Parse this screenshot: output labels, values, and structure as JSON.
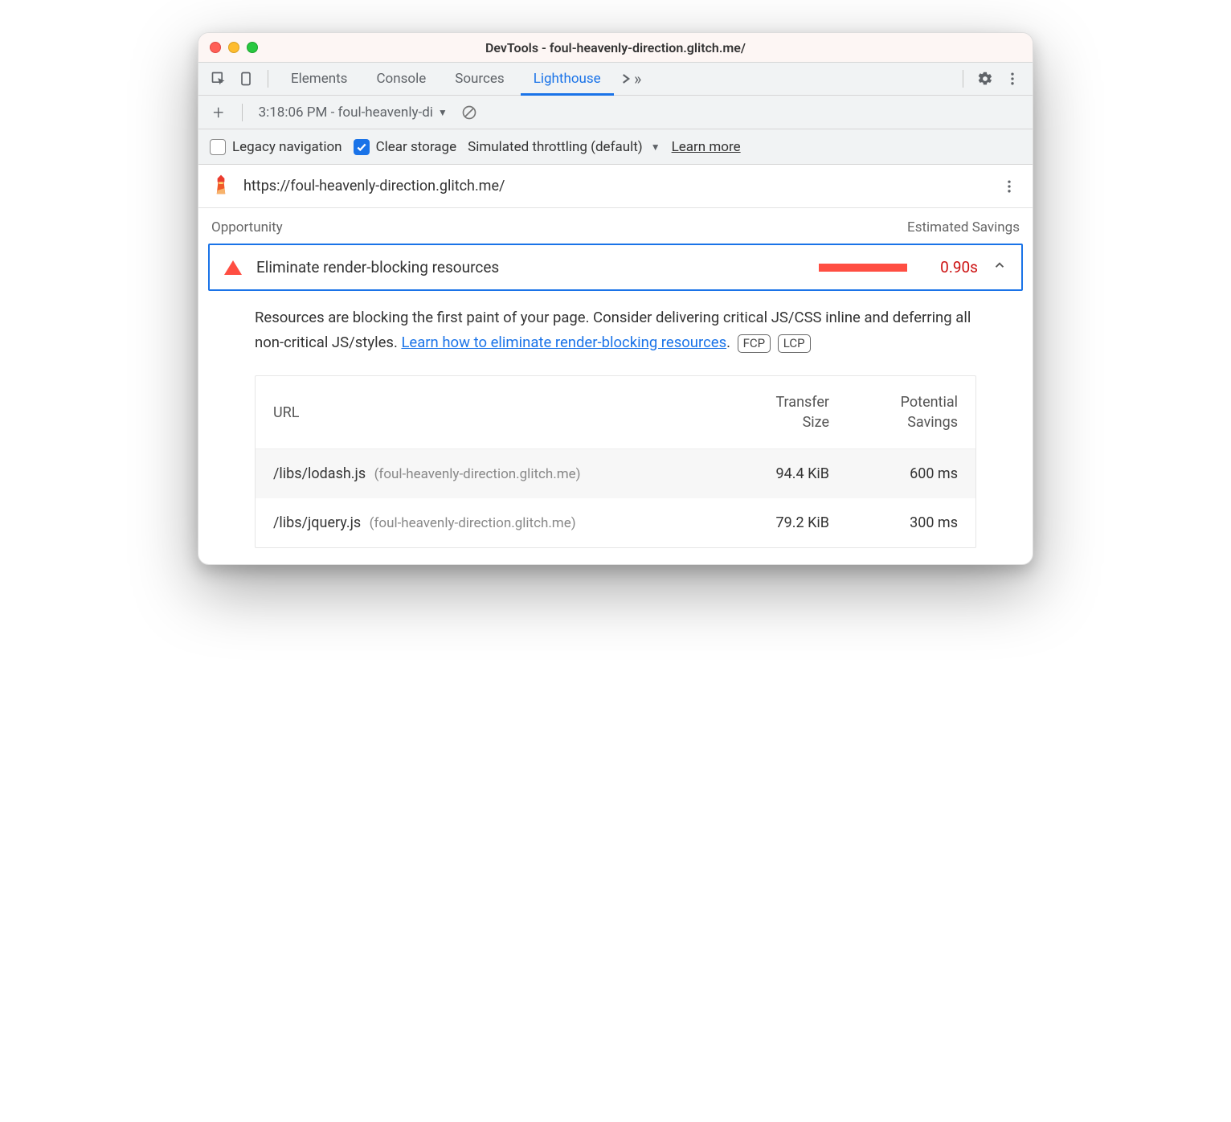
{
  "window": {
    "title": "DevTools - foul-heavenly-direction.glitch.me/"
  },
  "tabs": {
    "items": [
      "Elements",
      "Console",
      "Sources",
      "Lighthouse"
    ],
    "active": "Lighthouse"
  },
  "subbar": {
    "report_label": "3:18:06 PM - foul-heavenly-di"
  },
  "options": {
    "legacy_label": "Legacy navigation",
    "legacy_checked": false,
    "clear_label": "Clear storage",
    "clear_checked": true,
    "throttling_label": "Simulated throttling (default)",
    "learn_more": "Learn more"
  },
  "url_row": {
    "url": "https://foul-heavenly-direction.glitch.me/"
  },
  "opportunity": {
    "heading_left": "Opportunity",
    "heading_right": "Estimated Savings",
    "title": "Eliminate render-blocking resources",
    "savings": "0.90s"
  },
  "description": {
    "text_before_link": "Resources are blocking the first paint of your page. Consider delivering critical JS/CSS inline and deferring all non-critical JS/styles. ",
    "link_text": "Learn how to eliminate render-blocking resources",
    "text_after_link": ".",
    "badges": [
      "FCP",
      "LCP"
    ]
  },
  "table": {
    "headers": {
      "url": "URL",
      "size": "Transfer\nSize",
      "savings": "Potential\nSavings"
    },
    "rows": [
      {
        "path": "/libs/lodash.js",
        "host": "(foul-heavenly-direction.glitch.me)",
        "size": "94.4 KiB",
        "savings": "600 ms"
      },
      {
        "path": "/libs/jquery.js",
        "host": "(foul-heavenly-direction.glitch.me)",
        "size": "79.2 KiB",
        "savings": "300 ms"
      }
    ]
  }
}
